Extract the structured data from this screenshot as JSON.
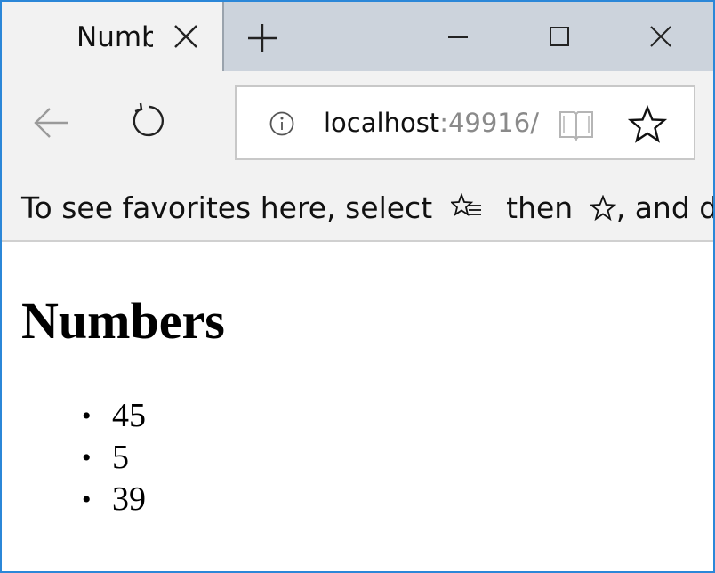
{
  "browser": {
    "tab": {
      "title": "Numbers"
    },
    "address": {
      "host": "localhost",
      "rest": ":49916/"
    },
    "favorites_bar": {
      "text_before": "To see favorites here, select",
      "text_middle": "then",
      "text_after": ", and dra"
    },
    "icons": {
      "tab_close": "close-icon",
      "new_tab": "plus-icon",
      "minimize": "minimize-icon",
      "maximize": "maximize-icon",
      "window_close": "close-icon",
      "back": "back-arrow-icon",
      "refresh": "refresh-icon",
      "site_info": "info-icon",
      "reading_view": "book-icon",
      "favorite": "star-icon",
      "favorites_hub": "favorites-list-icon",
      "favorites_star": "small-star-icon"
    },
    "colors": {
      "window_border": "#2b87d8",
      "titlebar": "#ccd3dc",
      "chrome": "#f2f2f2"
    }
  },
  "page": {
    "heading": "Numbers",
    "items": [
      "45",
      "5",
      "39"
    ]
  }
}
